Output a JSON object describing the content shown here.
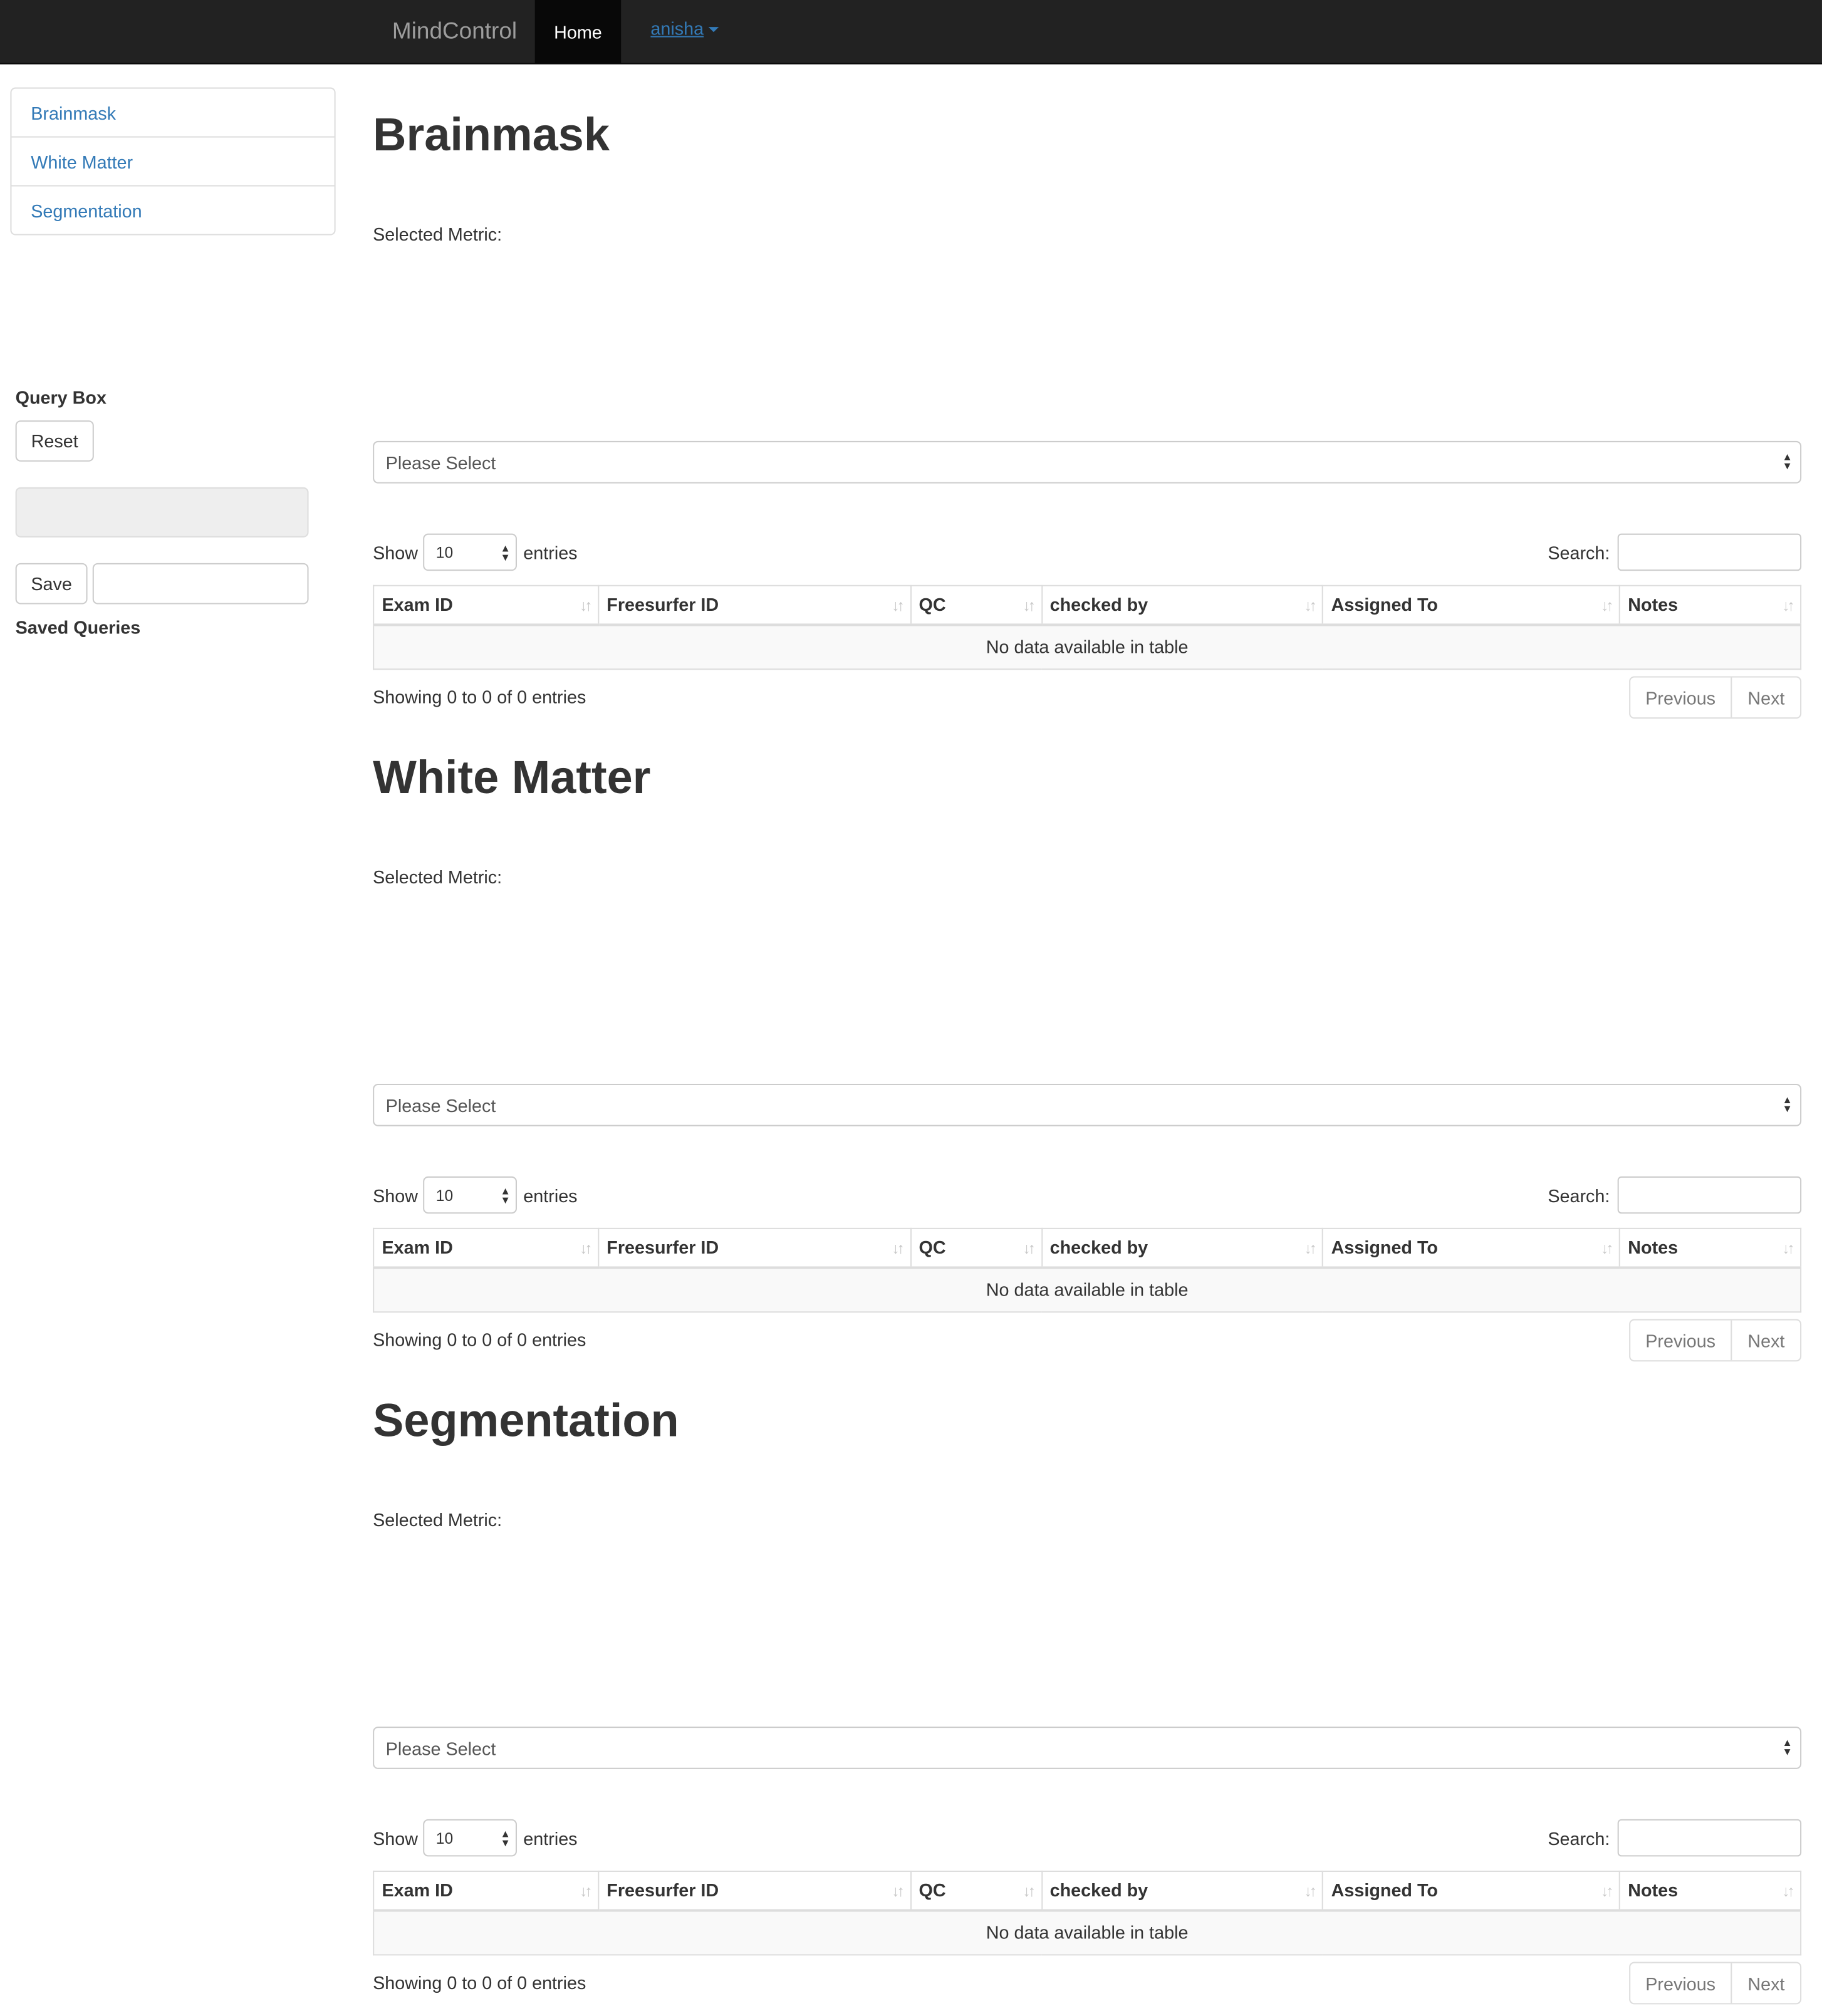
{
  "navbar": {
    "brand": "MindControl",
    "home": "Home",
    "user": "anisha"
  },
  "sidebar": {
    "items": [
      {
        "label": "Brainmask"
      },
      {
        "label": "White Matter"
      },
      {
        "label": "Segmentation"
      }
    ],
    "query_box_label": "Query Box",
    "reset_label": "Reset",
    "save_label": "Save",
    "saved_queries_label": "Saved Queries"
  },
  "sections": [
    {
      "title": "Brainmask",
      "metric_label": "Selected Metric:",
      "select_value": "Please Select",
      "show_label": "Show",
      "length_value": "10",
      "entries_label": "entries",
      "search_label": "Search:",
      "columns": [
        "Exam ID",
        "Freesurfer ID",
        "QC",
        "checked by",
        "Assigned To",
        "Notes"
      ],
      "empty_text": "No data available in table",
      "info": "Showing 0 to 0 of 0 entries",
      "prev": "Previous",
      "next": "Next"
    },
    {
      "title": "White Matter",
      "metric_label": "Selected Metric:",
      "select_value": "Please Select",
      "show_label": "Show",
      "length_value": "10",
      "entries_label": "entries",
      "search_label": "Search:",
      "columns": [
        "Exam ID",
        "Freesurfer ID",
        "QC",
        "checked by",
        "Assigned To",
        "Notes"
      ],
      "empty_text": "No data available in table",
      "info": "Showing 0 to 0 of 0 entries",
      "prev": "Previous",
      "next": "Next"
    },
    {
      "title": "Segmentation",
      "metric_label": "Selected Metric:",
      "select_value": "Please Select",
      "show_label": "Show",
      "length_value": "10",
      "entries_label": "entries",
      "search_label": "Search:",
      "columns": [
        "Exam ID",
        "Freesurfer ID",
        "QC",
        "checked by",
        "Assigned To",
        "Notes"
      ],
      "empty_text": "No data available in table",
      "info": "Showing 0 to 0 of 0 entries",
      "prev": "Previous",
      "next": "Next"
    }
  ]
}
